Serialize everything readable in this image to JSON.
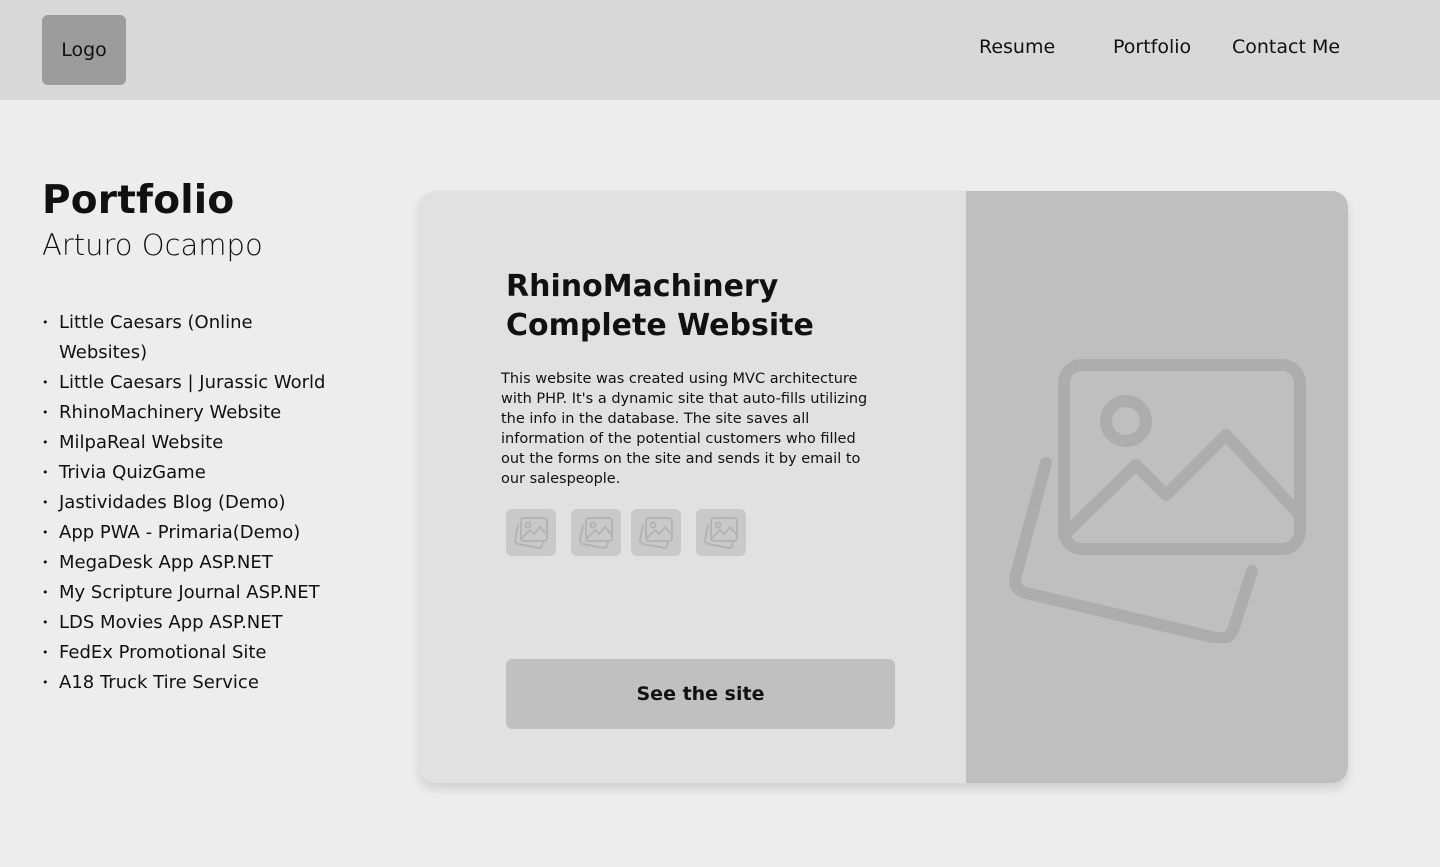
{
  "header": {
    "logo": "Logo",
    "nav": [
      "Resume",
      "Portfolio",
      "Contact Me"
    ]
  },
  "sidebar": {
    "title": "Portfolio",
    "subtitle": "Arturo Ocampo",
    "projects": [
      "Little Caesars (Online Websites)",
      "Little Caesars | Jurassic World",
      "RhinoMachinery Website",
      "MilpaReal Website",
      "Trivia QuizGame",
      "Jastividades Blog (Demo)",
      "App PWA - Primaria(Demo)",
      "MegaDesk App ASP.NET",
      "My Scripture Journal ASP.NET",
      "LDS Movies App ASP.NET",
      "FedEx Promotional Site",
      "A18 Truck Tire Service"
    ]
  },
  "card": {
    "title": "RhinoMachinery Complete Website",
    "description": "This website was created using MVC architecture with PHP. It's a dynamic site that auto-fills utilizing the info in the database. The site saves all information of the potential customers who filled out the forms on the site and sends it by email to our salespeople.",
    "thumbnail_icon": "image-icon",
    "main_image_icon": "image-icon",
    "button_label": "See the site"
  },
  "colors": {
    "page_bg": "#ededed",
    "header_bg": "#d8d8d8",
    "logo_bg": "#9c9c9c",
    "card_bg": "#e1e1e1",
    "image_bg": "#bfbfbf",
    "button_bg": "#c0c0c0"
  }
}
